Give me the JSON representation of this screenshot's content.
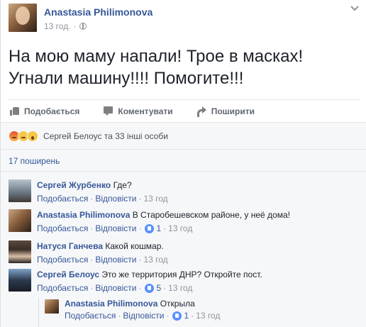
{
  "post": {
    "author": "Anastasia Philimonova",
    "time": "13 год.",
    "text": "На мою маму напали! Трое в масках! Угнали машину!!!! Помогите!!!",
    "actions": {
      "like": "Подобається",
      "comment": "Коментувати",
      "share": "Поширити"
    },
    "reactions_text": "Сергей Белоус та 33 інші особи",
    "shares": "17 поширень"
  },
  "comments": [
    {
      "author": "Сергей Журбенко",
      "text": "Где?",
      "like": "Подобається",
      "reply": "Відповісти",
      "likes": "",
      "time": "13 год"
    },
    {
      "author": "Anastasia Philimonova",
      "text": "В Старобешевском районе, у неё дома!",
      "like": "Подобається",
      "reply": "Відповісти",
      "likes": "1",
      "time": "13 год"
    },
    {
      "author": "Натуся Ганчева",
      "text": "Какой кошмар.",
      "like": "Подобається",
      "reply": "Відповісти",
      "likes": "",
      "time": "13 год"
    },
    {
      "author": "Сергей Белоус",
      "text": "Это же территория ДНР? Откройте пост.",
      "like": "Подобається",
      "reply": "Відповісти",
      "likes": "5",
      "time": "13 год"
    }
  ],
  "reply": {
    "author": "Anastasia Philimonova",
    "text": "Открыла",
    "like": "Подобається",
    "reply": "Відповісти",
    "likes": "1",
    "time": "13 год"
  },
  "colors": {
    "link": "#365899",
    "meta": "#90949c",
    "like_badge": "#5890ff",
    "background": "#f6f7f9"
  }
}
